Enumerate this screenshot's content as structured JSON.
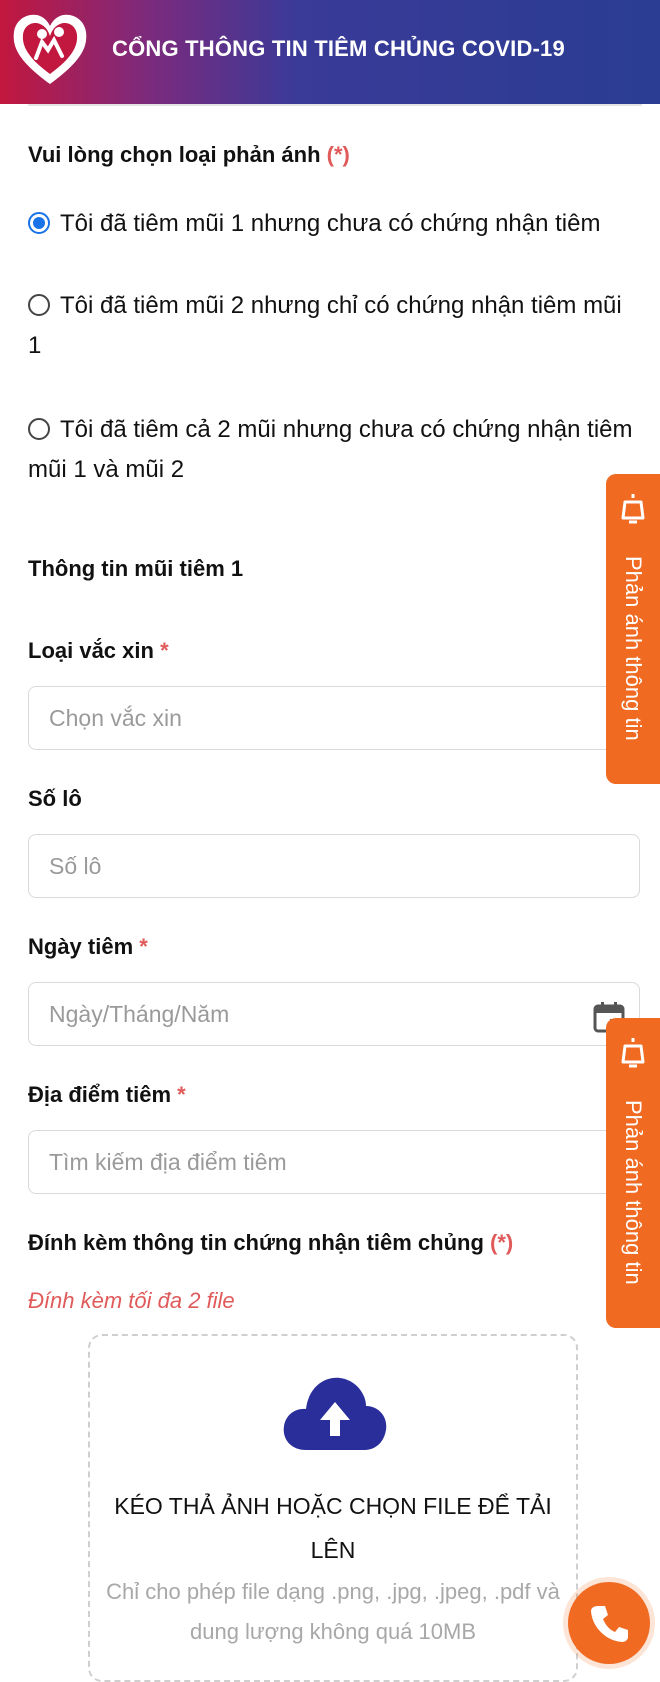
{
  "header": {
    "title": "CỔNG THÔNG TIN TIÊM CHỦNG COVID-19"
  },
  "report_type": {
    "label": "Vui lòng chọn loại phản ánh",
    "required": "(*)",
    "options": [
      {
        "text": "Tôi đã tiêm mũi 1 nhưng chưa có chứng nhận tiêm",
        "checked": true
      },
      {
        "text": "Tôi đã tiêm mũi 2 nhưng chỉ có chứng nhận tiêm mũi 1",
        "checked": false
      },
      {
        "text": "Tôi đã tiêm cả 2 mũi nhưng chưa có chứng nhận tiêm mũi 1 và mũi 2",
        "checked": false
      }
    ]
  },
  "dose1": {
    "section_title": "Thông tin mũi tiêm 1",
    "vaccine": {
      "label": "Loại vắc xin",
      "required": "*",
      "placeholder": "Chọn vắc xin"
    },
    "lot": {
      "label": "Số lô",
      "placeholder": "Số lô"
    },
    "date": {
      "label": "Ngày tiêm",
      "required": "*",
      "placeholder": "Ngày/Tháng/Năm"
    },
    "place": {
      "label": "Địa điểm tiêm",
      "required": "*",
      "placeholder": "Tìm kiếm địa điểm tiêm"
    }
  },
  "attachment": {
    "label": "Đính kèm thông tin chứng nhận tiêm chủng",
    "required": "(*)",
    "note": "Đính kèm tối đa 2 file",
    "dropzone_title": "KÉO THẢ ẢNH HOẶC CHỌN FILE ĐỂ TẢI LÊN",
    "dropzone_hint": "Chỉ cho phép file dạng .png, .jpg, .jpeg, .pdf và dung lượng không quá 10MB"
  },
  "side_tab": {
    "label": "Phản ánh thông tin"
  },
  "colors": {
    "accent": "#f06a22",
    "brand_dark": "#2a2e9a",
    "required": "#e05a5a",
    "radio_checked": "#1a73e8"
  },
  "icons": [
    "logo-heart-icon",
    "upload-cloud-icon",
    "calendar-icon",
    "megaphone-icon",
    "phone-icon"
  ]
}
